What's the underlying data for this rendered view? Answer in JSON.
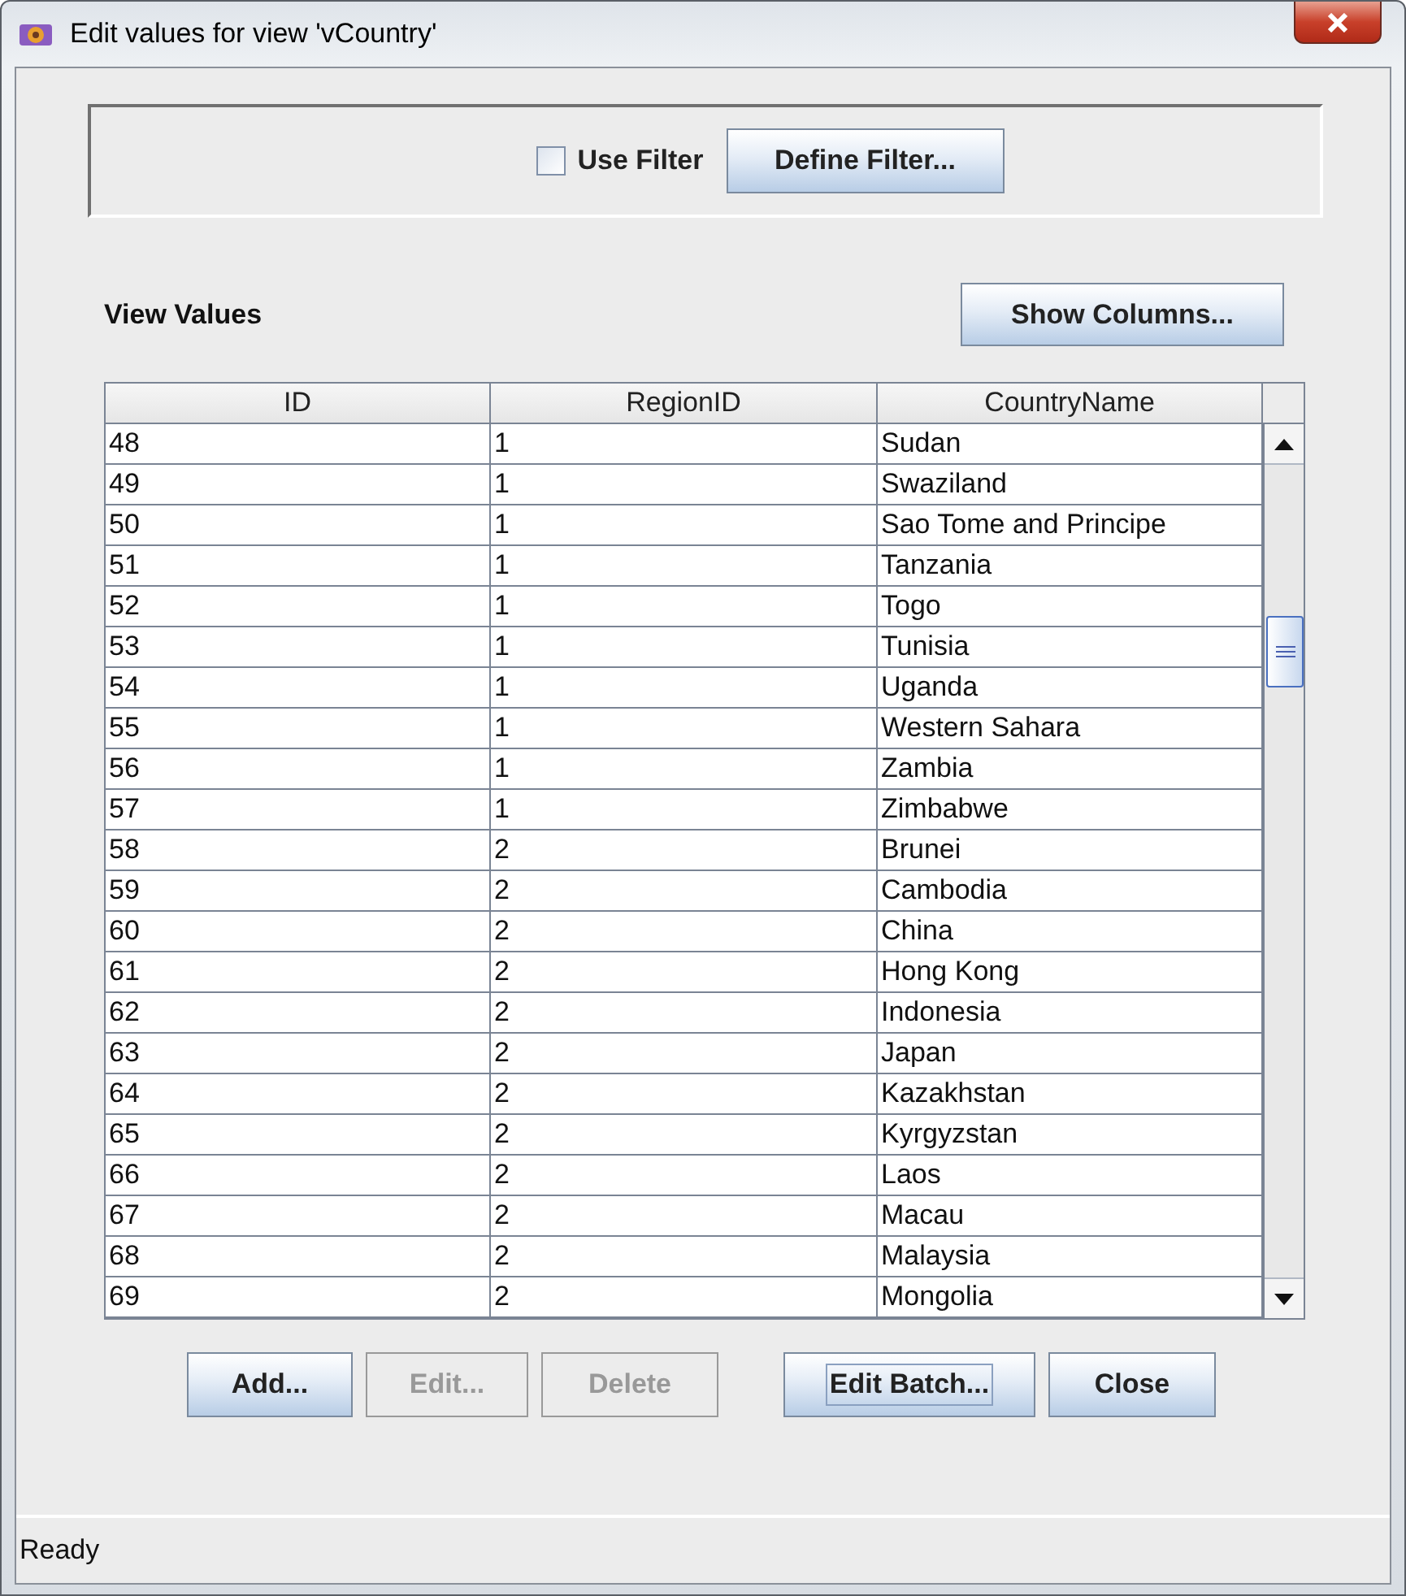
{
  "window": {
    "title": "Edit values for view 'vCountry'"
  },
  "filter": {
    "use_filter": {
      "label": "Use Filter",
      "checked": false
    },
    "define_button": "Define Filter..."
  },
  "section_title": "View Values",
  "show_columns_button": "Show Columns...",
  "table": {
    "columns": [
      "ID",
      "RegionID",
      "CountryName"
    ],
    "rows": [
      [
        "48",
        "1",
        "Sudan"
      ],
      [
        "49",
        "1",
        "Swaziland"
      ],
      [
        "50",
        "1",
        "Sao Tome and Principe"
      ],
      [
        "51",
        "1",
        "Tanzania"
      ],
      [
        "52",
        "1",
        "Togo"
      ],
      [
        "53",
        "1",
        "Tunisia"
      ],
      [
        "54",
        "1",
        "Uganda"
      ],
      [
        "55",
        "1",
        "Western Sahara"
      ],
      [
        "56",
        "1",
        "Zambia"
      ],
      [
        "57",
        "1",
        "Zimbabwe"
      ],
      [
        "58",
        "2",
        "Brunei"
      ],
      [
        "59",
        "2",
        "Cambodia"
      ],
      [
        "60",
        "2",
        "China"
      ],
      [
        "61",
        "2",
        "Hong Kong"
      ],
      [
        "62",
        "2",
        "Indonesia"
      ],
      [
        "63",
        "2",
        "Japan"
      ],
      [
        "64",
        "2",
        "Kazakhstan"
      ],
      [
        "65",
        "2",
        "Kyrgyzstan"
      ],
      [
        "66",
        "2",
        "Laos"
      ],
      [
        "67",
        "2",
        "Macau"
      ],
      [
        "68",
        "2",
        "Malaysia"
      ],
      [
        "69",
        "2",
        "Mongolia"
      ]
    ]
  },
  "buttons": [
    {
      "label": "Add...",
      "disabled": false,
      "focused": false
    },
    {
      "label": "Edit...",
      "disabled": true,
      "focused": false
    },
    {
      "label": "Delete",
      "disabled": true,
      "focused": false
    },
    {
      "label": "Edit Batch...",
      "disabled": false,
      "focused": true
    },
    {
      "label": "Close",
      "disabled": false,
      "focused": false
    }
  ],
  "status_bar": "Ready"
}
